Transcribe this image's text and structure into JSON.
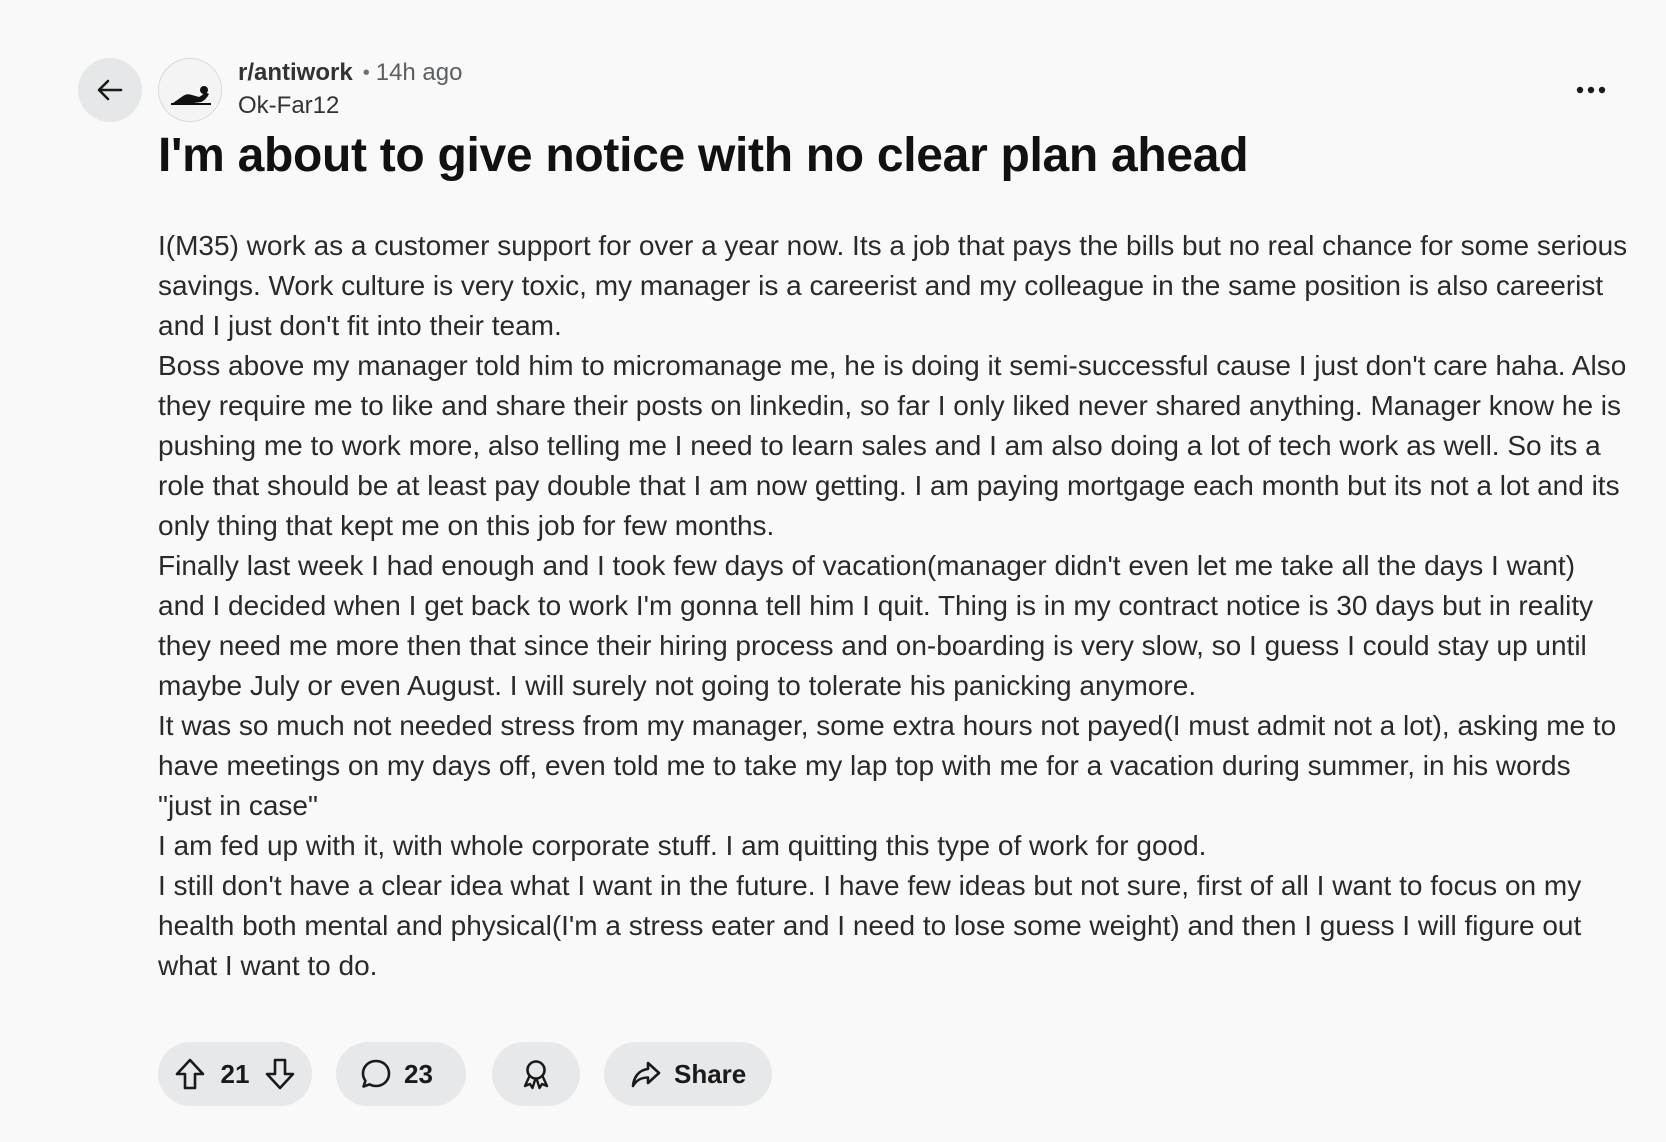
{
  "header": {
    "subreddit": "r/antiwork",
    "separator": "•",
    "time_ago": "14h ago",
    "author": "Ok-Far12"
  },
  "post": {
    "title": "I'm about to give notice with no clear plan ahead",
    "paragraphs": [
      "I(M35) work as a customer support for over a year now. Its a job that pays the bills but no real chance for some serious savings. Work culture is very toxic, my manager is a careerist and my colleague in the same position is also careerist and I just don't fit into their team.",
      "Boss above my manager told him to micromanage me, he is doing it semi-successful cause I just don't care haha. Also they require me to like and share their posts on linkedin, so far I only liked never shared anything. Manager know he is pushing me to work more, also telling me I need to learn sales and I am also doing a lot of tech work as well. So its a role that should be at least pay double that I am now getting. I am paying mortgage each month but its not a lot and its only thing that kept me on this job for few months.",
      "Finally last week I had enough and I took few days of vacation(manager didn't even let me take all the days I want) and I decided when I get back to work I'm gonna tell him I quit. Thing is in my contract notice is 30 days but in reality they need me more then that since their hiring process and on-boarding is very slow, so I guess I could stay up until maybe July or even August. I will surely not going to tolerate his panicking anymore.",
      "It was so much not needed stress from my manager, some extra hours not payed(I must admit not a lot), asking me to have meetings on my days off, even told me to take my lap top with me for a vacation during summer, in his words \"just in case\"",
      "I am fed up with it, with whole corporate stuff. I am quitting this type of work for good.",
      "I still don't have a clear idea what I want in the future. I have few ideas but not sure, first of all I want to focus on my health both mental and physical(I'm a stress eater and I need to lose some weight) and then I guess I will figure out what I want to do."
    ]
  },
  "actions": {
    "vote_count": "21",
    "comment_count": "23",
    "share_label": "Share"
  },
  "icons": {
    "back": "arrow-left-icon",
    "more": "ellipsis-icon",
    "upvote": "upvote-arrow-icon",
    "downvote": "downvote-arrow-icon",
    "comment": "speech-bubble-icon",
    "award": "award-ribbon-icon",
    "share": "share-arrow-icon"
  }
}
